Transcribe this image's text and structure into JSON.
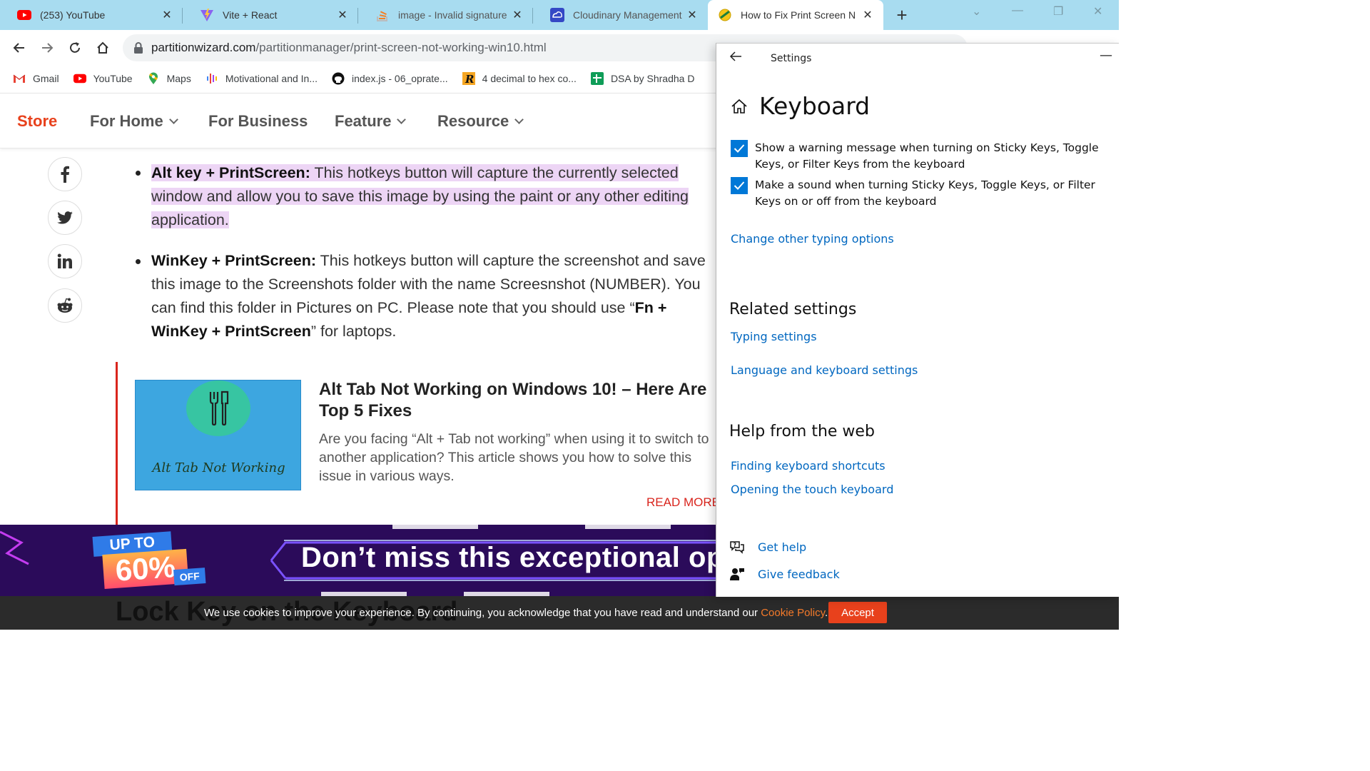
{
  "browser": {
    "tabs": [
      {
        "title": "(253) YouTube",
        "icon": "youtube-icon"
      },
      {
        "title": "Vite + React",
        "icon": "vite-icon"
      },
      {
        "title": "image - Invalid signature",
        "icon": "stackoverflow-icon"
      },
      {
        "title": "Cloudinary Management",
        "icon": "cloudinary-icon"
      },
      {
        "title": "How to Fix Print Screen N",
        "icon": "partitionwizard-icon",
        "active": true
      }
    ],
    "url_domain": "partitionwizard.com",
    "url_path": "/partitionmanager/print-screen-not-working-win10.html",
    "bookmarks": [
      {
        "label": "Gmail",
        "icon": "gmail-icon"
      },
      {
        "label": "YouTube",
        "icon": "youtube-icon"
      },
      {
        "label": "Maps",
        "icon": "maps-icon"
      },
      {
        "label": "Motivational and In...",
        "icon": "podcast-icon"
      },
      {
        "label": "index.js - 06_oprate...",
        "icon": "github-icon"
      },
      {
        "label": "4 decimal to hex co...",
        "icon": "r-icon"
      },
      {
        "label": "DSA by Shradha D",
        "icon": "sheets-icon"
      }
    ]
  },
  "site": {
    "nav": {
      "store": "Store",
      "for_home": "For Home",
      "for_business": "For Business",
      "feature": "Feature",
      "resource": "Resource"
    },
    "article": {
      "bullet1_bold": "Alt key + PrintScreen:",
      "bullet1_rest": " This hotkeys button will capture the currently selected window and allow you to save this image by using the paint or any other editing application.",
      "bullet2_bold": "WinKey + PrintScreen:",
      "bullet2_rest": "  This hotkeys button will capture the screenshot and save this image to the Screenshots folder with the name Screesnshot (NUMBER). You can find this folder in Pictures on PC. Please note that you should use “",
      "bullet2_bold2": "Fn + WinKey + PrintScreen",
      "bullet2_end": "” for laptops."
    },
    "related": {
      "thumb_text": "Alt Tab Not Working",
      "title": "Alt Tab Not Working on Windows 10! – Here Are Top 5 Fixes",
      "description": "Are you facing “Alt + Tab not working” when using it to switch to another application? This article shows you how to solve this issue in various ways.",
      "read_more": "READ MORE"
    },
    "banner": {
      "up_to": "UP TO",
      "percent": "60%",
      "off": "OFF",
      "headline": "Don’t miss this exceptional opp"
    },
    "next_heading": "Lock Key on the Keyboard",
    "cookie": {
      "text": "We use cookies to improve your experience. By continuing, you acknowledge that you have read and understand our ",
      "link": "Cookie Policy",
      "end": ".",
      "accept": "Accept"
    }
  },
  "settings": {
    "window_title": "Settings",
    "page_title": "Keyboard",
    "checkbox1": "Show a warning message when turning on Sticky Keys, Toggle Keys, or Filter Keys from the keyboard",
    "checkbox2": "Make a sound when turning Sticky Keys, Toggle Keys, or Filter Keys on or off from the keyboard",
    "change_typing": "Change other typing options",
    "related_heading": "Related settings",
    "typing_settings": "Typing settings",
    "language_keyboard": "Language and keyboard settings",
    "help_heading": "Help from the web",
    "finding_shortcuts": "Finding keyboard shortcuts",
    "opening_touch": "Opening the touch keyboard",
    "get_help": "Get help",
    "give_feedback": "Give feedback"
  },
  "colors": {
    "accent_red": "#e8411c",
    "windows_blue": "#0078d7",
    "link_blue": "#0067c0",
    "highlight": "#edd5f5"
  }
}
